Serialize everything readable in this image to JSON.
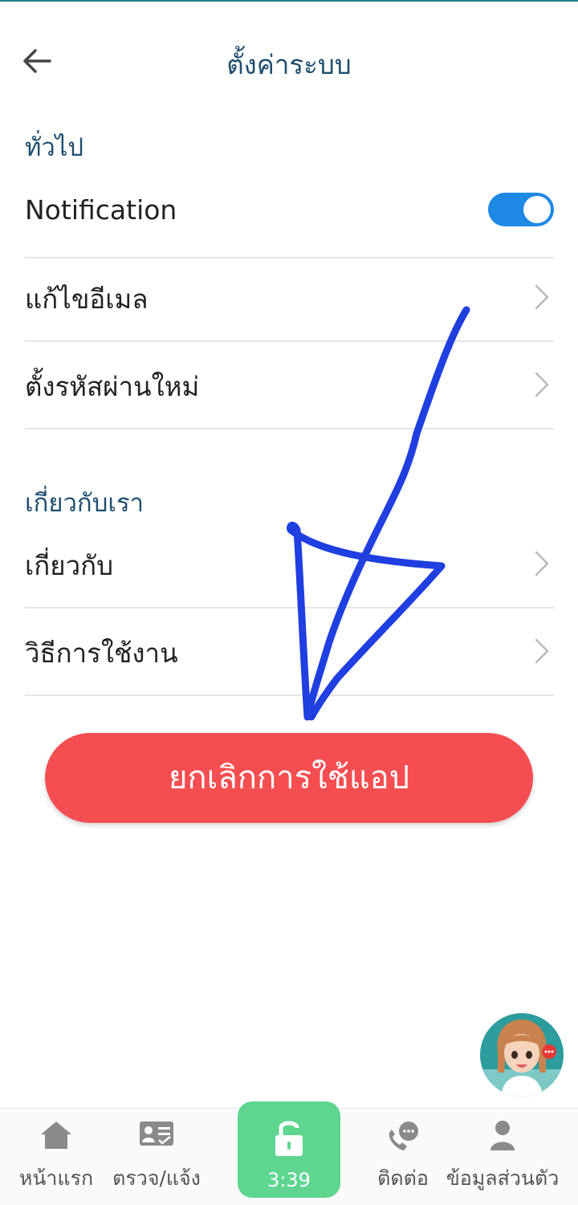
{
  "header": {
    "title": "ตั้งค่าระบบ"
  },
  "sections": {
    "general": {
      "title": "ทั่วไป",
      "notification_label": "Notification",
      "notification_enabled": true,
      "edit_email_label": "แก้ไขอีเมล",
      "new_password_label": "ตั้งรหัสผ่านใหม่"
    },
    "about_us": {
      "title": "เกี่ยวกับเรา",
      "about_label": "เกี่ยวกับ",
      "how_to_use_label": "วิธีการใช้งาน"
    }
  },
  "cancel_app_button": "ยกเลิกการใช้แอป",
  "bottom_nav": {
    "home": "หน้าแรก",
    "check_report": "ตรวจ/แจ้ง",
    "lock_timer": "3:39",
    "contact": "ติดต่อ",
    "profile": "ข้อมูลส่วนตัว"
  },
  "colors": {
    "accent_title": "#1f4e6e",
    "toggle_on": "#1e88e5",
    "cancel_button": "#f54e51",
    "lock_button": "#5ed68f",
    "annotation_arrow": "#1f3fe0"
  },
  "icons": [
    "back-arrow-icon",
    "chevron-right-icon",
    "home-icon",
    "id-card-icon",
    "lock-icon",
    "phone-chat-icon",
    "person-icon"
  ]
}
